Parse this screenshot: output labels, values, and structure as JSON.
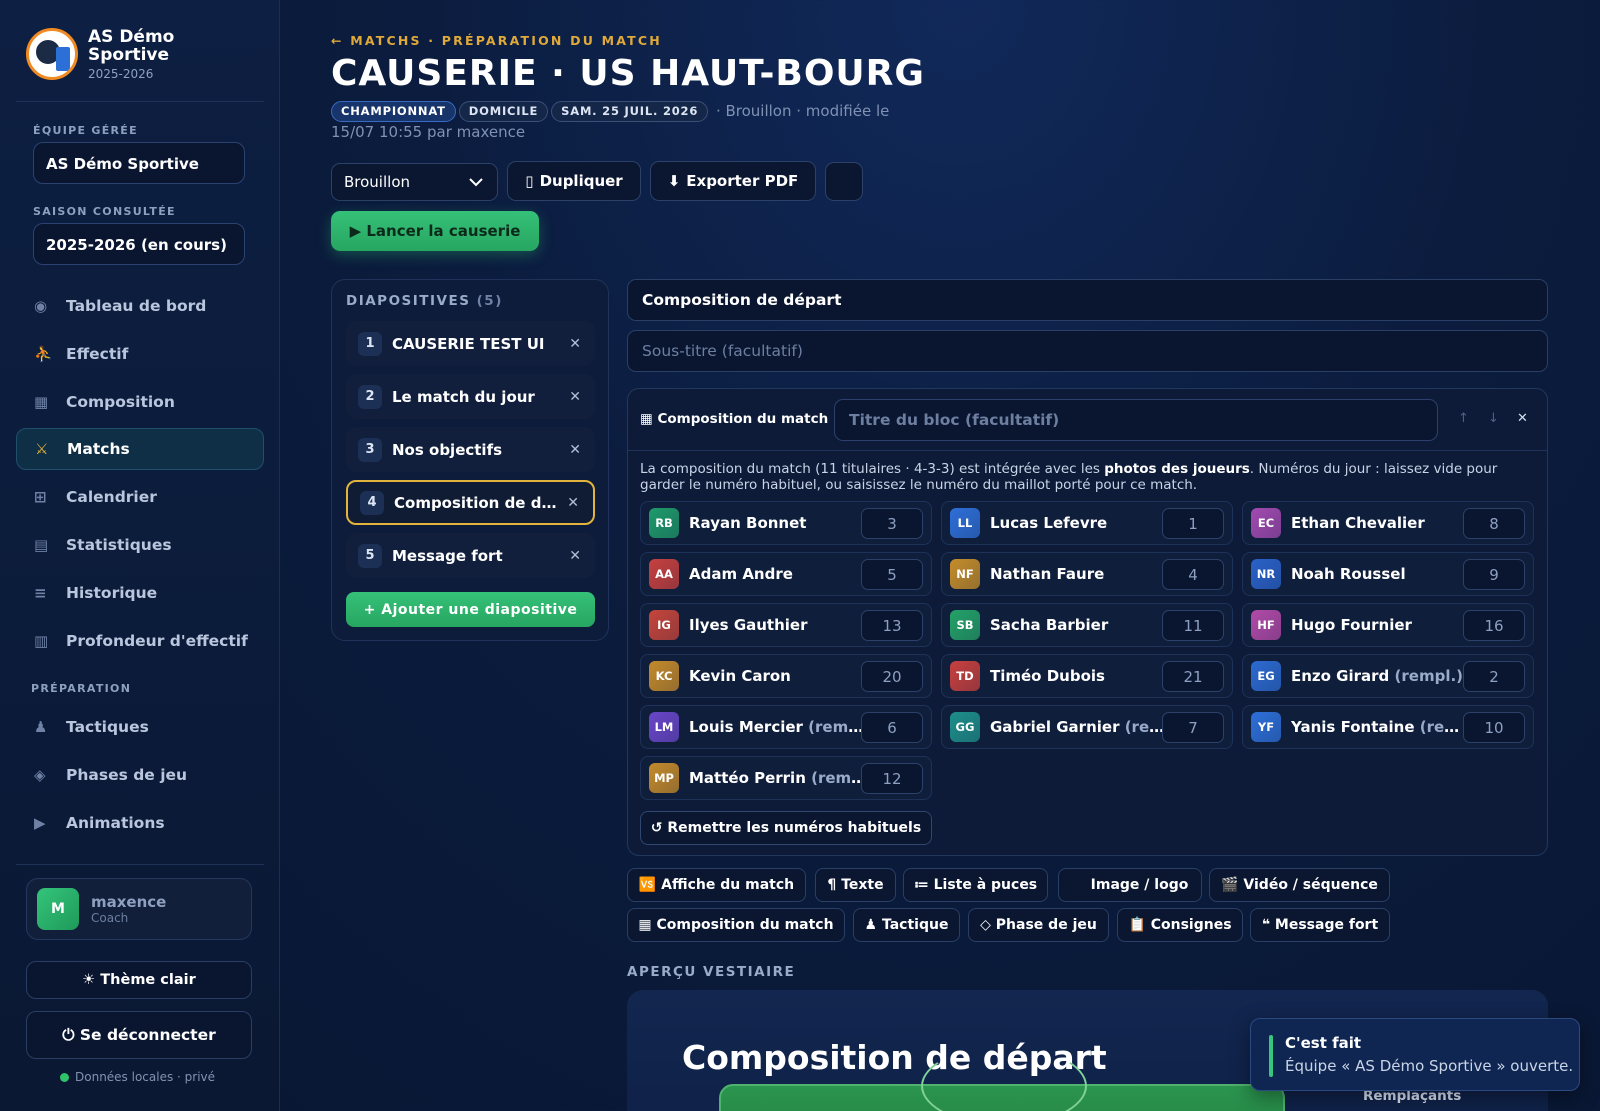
{
  "sidebar": {
    "brand_name": "AS Démo Sportive",
    "brand_season": "2025-2026",
    "team_label": "ÉQUIPE GÉRÉE",
    "team_value": "AS Démo Sportive",
    "season_label": "SAISON CONSULTÉE",
    "season_value": "2025-2026 (en cours)",
    "nav": [
      {
        "label": "Tableau de bord",
        "icon": "◉"
      },
      {
        "label": "Effectif",
        "icon": "⛹"
      },
      {
        "label": "Composition",
        "icon": "▦"
      },
      {
        "label": "Matchs",
        "icon": "⚔"
      },
      {
        "label": "Calendrier",
        "icon": "⊞"
      },
      {
        "label": "Statistiques",
        "icon": "▤"
      },
      {
        "label": "Historique",
        "icon": "≡"
      },
      {
        "label": "Profondeur d'effectif",
        "icon": "▥"
      }
    ],
    "prep_label": "PRÉPARATION",
    "prep_nav": [
      {
        "label": "Tactiques",
        "icon": "♟"
      },
      {
        "label": "Phases de jeu",
        "icon": "◈"
      },
      {
        "label": "Animations",
        "icon": "▶"
      }
    ],
    "user_initial": "M",
    "user_name": "maxence",
    "user_role": "Coach",
    "theme_button": "☀ Thème clair",
    "logout_button": "⏻ Se déconnecter",
    "local_data": "Données locales · privé"
  },
  "header": {
    "breadcrumb": "← MATCHS · PRÉPARATION DU MATCH",
    "title": "CAUSERIE · US HAUT-BOURG",
    "tags": [
      "CHAMPIONNAT",
      "DOMICILE",
      "SAM. 25 JUIL. 2026"
    ],
    "meta": "· Brouillon · modifiée le 15/07 10:55 par maxence"
  },
  "toolbar": {
    "status": "Brouillon",
    "duplicate": "Dupliquer",
    "export": "Exporter PDF",
    "launch": "▶ Lancer la causerie"
  },
  "slides_panel": {
    "title": "DIAPOSITIVES",
    "count": "(5)",
    "slides": [
      {
        "num": "1",
        "label": "CAUSERIE TEST UI"
      },
      {
        "num": "2",
        "label": "Le match du jour"
      },
      {
        "num": "3",
        "label": "Nos objectifs"
      },
      {
        "num": "4",
        "label": "Composition de d…"
      },
      {
        "num": "5",
        "label": "Message fort"
      }
    ],
    "add": "+ Ajouter une diapositive"
  },
  "editor": {
    "slide_title": "Composition de départ",
    "subtitle_placeholder": "Sous-titre (facultatif)",
    "block_label": "Composition du match",
    "block_title_placeholder": "Titre du bloc (facultatif)",
    "desc_1": "La composition du match (11 titulaires · 4-3-3) est intégrée avec les ",
    "desc_bold": "photos des joueurs",
    "desc_2": ". Numéros du jour : laissez vide pour garder le numéro habituel, ou saisissez le numéro du maillot porté pour ce match.",
    "reset": "↺ Remettre les numéros habituels"
  },
  "players": [
    {
      "initials": "RB",
      "name": "Rayan Bonnet",
      "suffix": "",
      "num": "3",
      "color": "#1f9a6a"
    },
    {
      "initials": "LL",
      "name": "Lucas Lefevre",
      "suffix": "",
      "num": "1",
      "color": "#2f6fd8"
    },
    {
      "initials": "EC",
      "name": "Ethan Chevalier",
      "suffix": "",
      "num": "8",
      "color": "#a24ab0"
    },
    {
      "initials": "AA",
      "name": "Adam Andre",
      "suffix": "",
      "num": "5",
      "color": "#c7403f"
    },
    {
      "initials": "NF",
      "name": "Nathan Faure",
      "suffix": "",
      "num": "4",
      "color": "#c58d2a"
    },
    {
      "initials": "NR",
      "name": "Noah Roussel",
      "suffix": "",
      "num": "9",
      "color": "#2a62c9"
    },
    {
      "initials": "IG",
      "name": "Ilyes Gauthier",
      "suffix": "",
      "num": "13",
      "color": "#c6453b"
    },
    {
      "initials": "SB",
      "name": "Sacha Barbier",
      "suffix": "",
      "num": "11",
      "color": "#24a268"
    },
    {
      "initials": "HF",
      "name": "Hugo Fournier",
      "suffix": "",
      "num": "16",
      "color": "#b24aa8"
    },
    {
      "initials": "KC",
      "name": "Kevin Caron",
      "suffix": "",
      "num": "20",
      "color": "#c48a2b"
    },
    {
      "initials": "TD",
      "name": "Timéo Dubois",
      "suffix": "",
      "num": "21",
      "color": "#c7403f"
    },
    {
      "initials": "EG",
      "name": "Enzo Girard",
      "suffix": " (rempl.)",
      "num": "2",
      "color": "#2c6ad0"
    },
    {
      "initials": "LM",
      "name": "Louis Mercier",
      "suffix": " (rempl.)",
      "num": "6",
      "color": "#6a46c8"
    },
    {
      "initials": "GG",
      "name": "Gabriel Garnier",
      "suffix": " (rempl.)",
      "num": "7",
      "color": "#1e8f8a"
    },
    {
      "initials": "YF",
      "name": "Yanis Fontaine",
      "suffix": " (rempl.)",
      "num": "10",
      "color": "#2d6fd8"
    },
    {
      "initials": "MP",
      "name": "Mattéo Perrin",
      "suffix": " (rempl.)",
      "num": "12",
      "color": "#c48a2b"
    }
  ],
  "block_types": [
    "🆚 Affiche du match",
    "¶ Texte",
    "≔ Liste à puces",
    "Image / logo",
    "🎬 Vidéo / séquence",
    "▦ Composition du match",
    "♟ Tactique",
    "◇ Phase de jeu",
    "📋 Consignes",
    "❝ Message fort"
  ],
  "preview": {
    "label": "APERÇU VESTIAIRE",
    "title": "Composition de départ",
    "subs": "Remplaçants"
  },
  "toast": {
    "title": "C'est fait",
    "message": "Équipe « AS Démo Sportive » ouverte."
  },
  "colors": {
    "accent": "#e0a93a",
    "green": "#2fb36c",
    "bg": "#0b1c3e"
  }
}
